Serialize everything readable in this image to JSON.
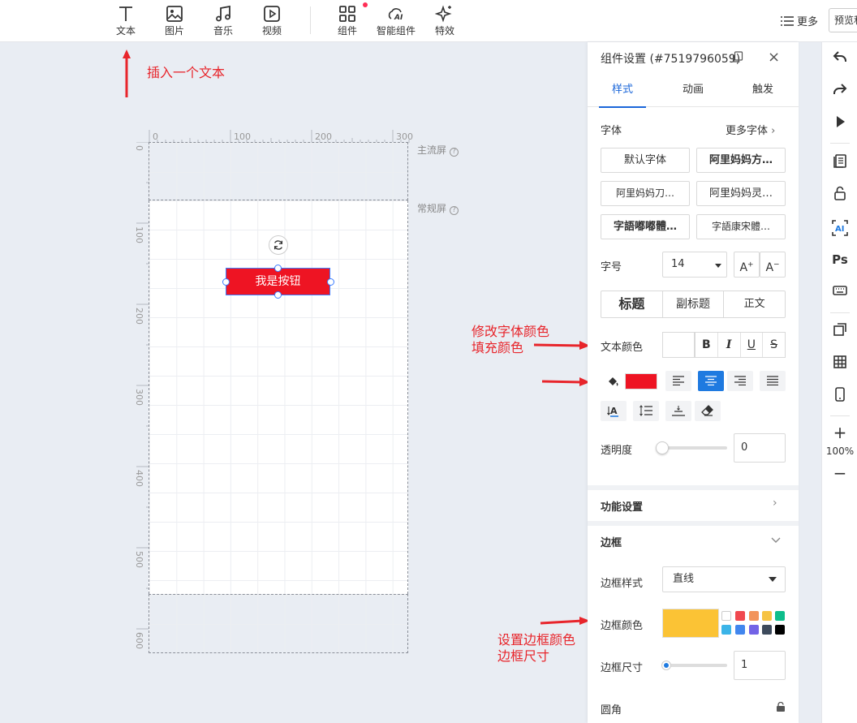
{
  "toolbar": {
    "items": [
      {
        "label": "文本",
        "icon": "text-icon"
      },
      {
        "label": "图片",
        "icon": "image-icon"
      },
      {
        "label": "音乐",
        "icon": "music-icon"
      },
      {
        "label": "视频",
        "icon": "video-icon"
      },
      {
        "label": "组件",
        "icon": "components-icon"
      },
      {
        "label": "智能组件",
        "icon": "ai-component-icon"
      },
      {
        "label": "特效",
        "icon": "sparkle-icon"
      }
    ],
    "more_label": "更多",
    "preview_label": "预览和"
  },
  "annotations": {
    "insert_text": "插入一个文本",
    "font_color": "修改字体颜色\n填充颜色",
    "border": "设置边框颜色\n边框尺寸"
  },
  "canvas": {
    "ruler_h": [
      "0",
      "100",
      "200",
      "300"
    ],
    "ruler_v": [
      "0",
      "100",
      "200",
      "300",
      "400",
      "500",
      "600"
    ],
    "zone_main_label": "主流屏",
    "zone_regular_label": "常规屏",
    "button_text": "我是按钮"
  },
  "panel": {
    "title": "组件设置 (#7519796059)",
    "tabs": [
      "样式",
      "动画",
      "触发"
    ],
    "font_label": "字体",
    "more_fonts": "更多字体",
    "fonts": [
      "默认字体",
      "阿里妈妈方…",
      "阿里妈妈刀…",
      "阿里妈妈灵…",
      "字語嘟嘟體…",
      "字語康宋體…"
    ],
    "size_label": "字号",
    "size_value": "14",
    "heading_options": [
      "标题",
      "副标题",
      "正文"
    ],
    "text_color_label": "文本颜色",
    "style_buttons": [
      "B",
      "I",
      "U",
      "S"
    ],
    "opacity_label": "透明度",
    "opacity_value": "0",
    "function_settings": "功能设置",
    "border_section": "边框",
    "border_style_label": "边框样式",
    "border_style_value": "直线",
    "border_color_label": "边框颜色",
    "border_size_label": "边框尺寸",
    "border_size_value": "1",
    "corner_label": "圆角",
    "fill_color": "#ee1423",
    "border_color": "#fbc335",
    "palette": [
      "#ffffff",
      "#f0484f",
      "#f2935a",
      "#f6c343",
      "#0dbd8b",
      "#3bb4e8",
      "#4186ee",
      "#7263e6",
      "#3d4a5c",
      "#000000"
    ]
  },
  "sidebar": {
    "zoom": "100%"
  }
}
